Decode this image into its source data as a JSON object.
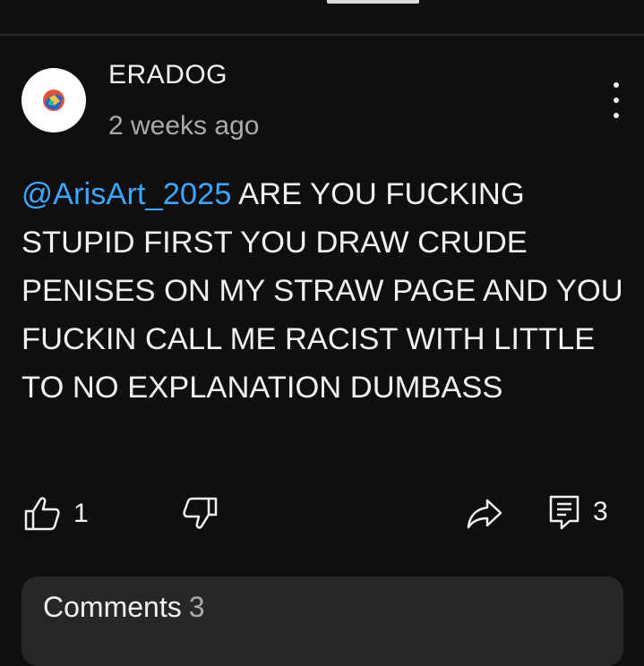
{
  "comment": {
    "author": "ERADOG",
    "timestamp": "2 weeks ago",
    "mention": "@ArisArt_2025",
    "text": "ARE YOU FUCKING STUPID FIRST YOU DRAW CRUDE PENISES ON MY STRAW PAGE AND YOU FUCKIN CALL ME RACIST WITH LITTLE TO NO EXPLANATION DUMBASS",
    "like_count": "1",
    "reply_count": "3"
  },
  "comments_panel": {
    "label": "Comments",
    "count": "3"
  },
  "colors": {
    "background": "#0f0f0f",
    "mention": "#3ea6ff",
    "panel": "#272727",
    "secondary_text": "#aaaaaa"
  },
  "icons": [
    "thumbs-up-icon",
    "thumbs-down-icon",
    "share-icon",
    "reply-icon",
    "more-vert-icon"
  ]
}
